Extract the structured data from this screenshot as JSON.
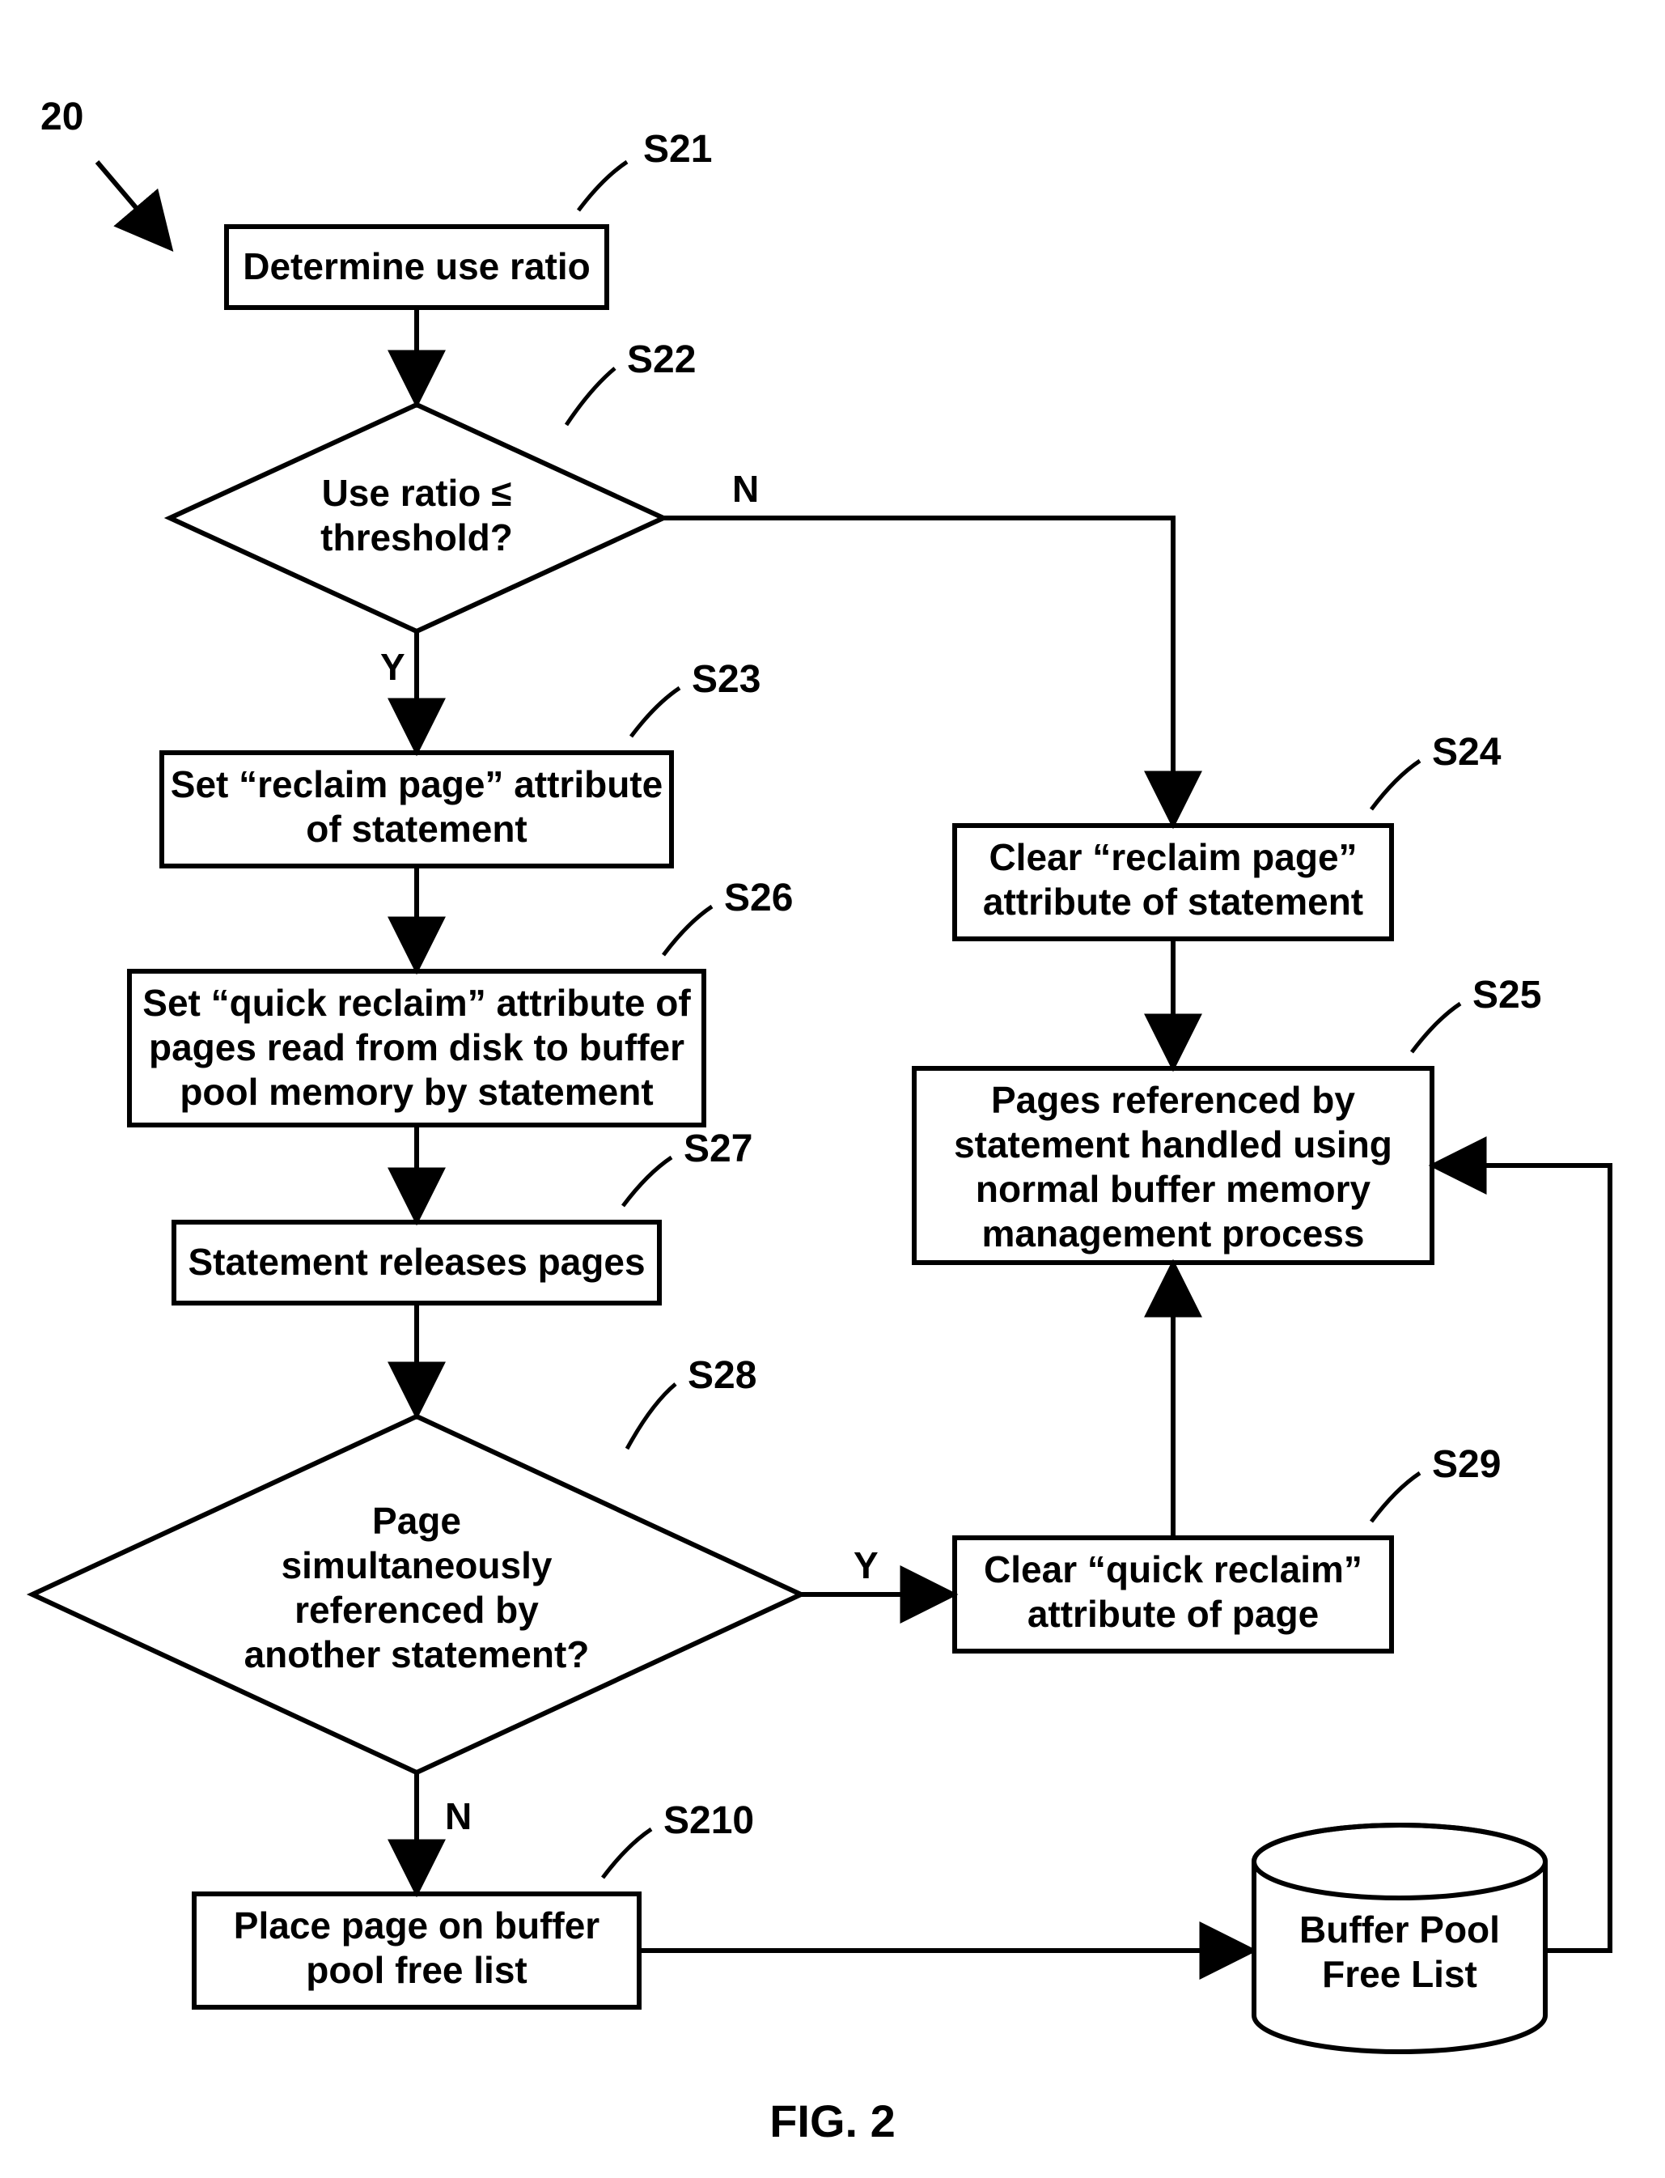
{
  "diagram": {
    "ref_number": "20",
    "figure_caption": "FIG. 2",
    "nodes": {
      "s21": {
        "label": "S21",
        "text": "Determine use ratio"
      },
      "s22": {
        "label": "S22",
        "text_line1": "Use ratio ≤",
        "text_line2": "threshold?"
      },
      "s23": {
        "label": "S23",
        "text_line1": "Set “reclaim page” attribute",
        "text_line2": "of statement"
      },
      "s24": {
        "label": "S24",
        "text_line1": "Clear “reclaim page”",
        "text_line2": "attribute of statement"
      },
      "s25": {
        "label": "S25",
        "text_line1": "Pages referenced by",
        "text_line2": "statement handled using",
        "text_line3": "normal buffer memory",
        "text_line4": "management process"
      },
      "s26": {
        "label": "S26",
        "text_line1": "Set “quick reclaim” attribute of",
        "text_line2": "pages read from disk to buffer",
        "text_line3": "pool memory by statement"
      },
      "s27": {
        "label": "S27",
        "text": "Statement releases pages"
      },
      "s28": {
        "label": "S28",
        "text_line1": "Page",
        "text_line2": "simultaneously",
        "text_line3": "referenced by",
        "text_line4": "another statement?"
      },
      "s29": {
        "label": "S29",
        "text_line1": "Clear “quick reclaim”",
        "text_line2": "attribute of page"
      },
      "s210": {
        "label": "S210",
        "text_line1": "Place page on buffer",
        "text_line2": "pool free list"
      },
      "cylinder": {
        "text_line1": "Buffer Pool",
        "text_line2": "Free List"
      }
    },
    "edge_labels": {
      "s22_yes": "Y",
      "s22_no": "N",
      "s28_yes": "Y",
      "s28_no": "N"
    }
  }
}
